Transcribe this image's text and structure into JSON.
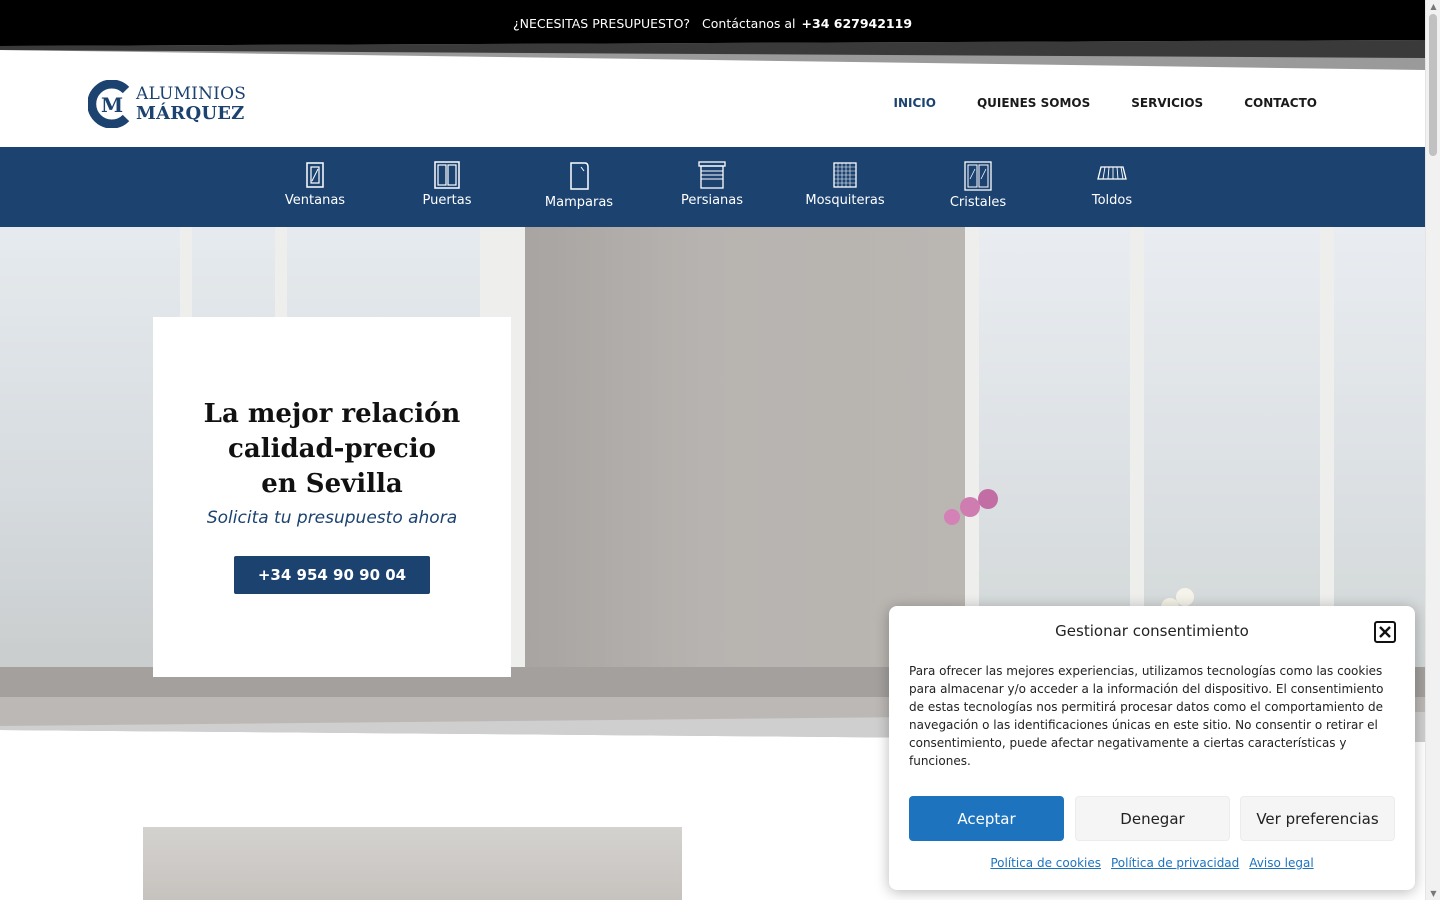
{
  "topbar": {
    "question": "¿NECESITAS PRESUPUESTO?",
    "contact_prefix": "Contáctanos al",
    "phone": "+34 627942119"
  },
  "logo": {
    "mark": "M",
    "line1": "ALUMINIOS",
    "line2": "MÁRQUEZ"
  },
  "nav": {
    "items": [
      {
        "label": "INICIO",
        "active": true
      },
      {
        "label": "QUIENES SOMOS"
      },
      {
        "label": "SERVICIOS"
      },
      {
        "label": "CONTACTO"
      }
    ]
  },
  "categories": [
    {
      "label": "Ventanas",
      "icon": "window-icon"
    },
    {
      "label": "Puertas",
      "icon": "door-icon"
    },
    {
      "label": "Mamparas",
      "icon": "shower-screen-icon"
    },
    {
      "label": "Persianas",
      "icon": "blind-icon"
    },
    {
      "label": "Mosquiteras",
      "icon": "mosquito-net-icon"
    },
    {
      "label": "Cristales",
      "icon": "glass-icon"
    },
    {
      "label": "Toldos",
      "icon": "awning-icon"
    }
  ],
  "hero": {
    "title_line1": "La mejor relación",
    "title_line2": "calidad-precio",
    "title_line3": "en Sevilla",
    "subtitle": "Solicita tu presupuesto ahora",
    "button": "+34 954 90 90 04"
  },
  "cookie": {
    "title": "Gestionar consentimiento",
    "text": "Para ofrecer las mejores experiencias, utilizamos tecnologías como las cookies para almacenar y/o acceder a la información del dispositivo. El consentimiento de estas tecnologías nos permitirá procesar datos como el comportamiento de navegación o las identificaciones únicas en este sitio. No consentir o retirar el consentimiento, puede afectar negativamente a ciertas características y funciones.",
    "accept": "Aceptar",
    "deny": "Denegar",
    "preferences": "Ver preferencias",
    "links": {
      "cookies": "Política de cookies",
      "privacy": "Política de privacidad",
      "legal": "Aviso legal"
    }
  },
  "colors": {
    "brand": "#1c4270",
    "accept": "#1e73be"
  }
}
